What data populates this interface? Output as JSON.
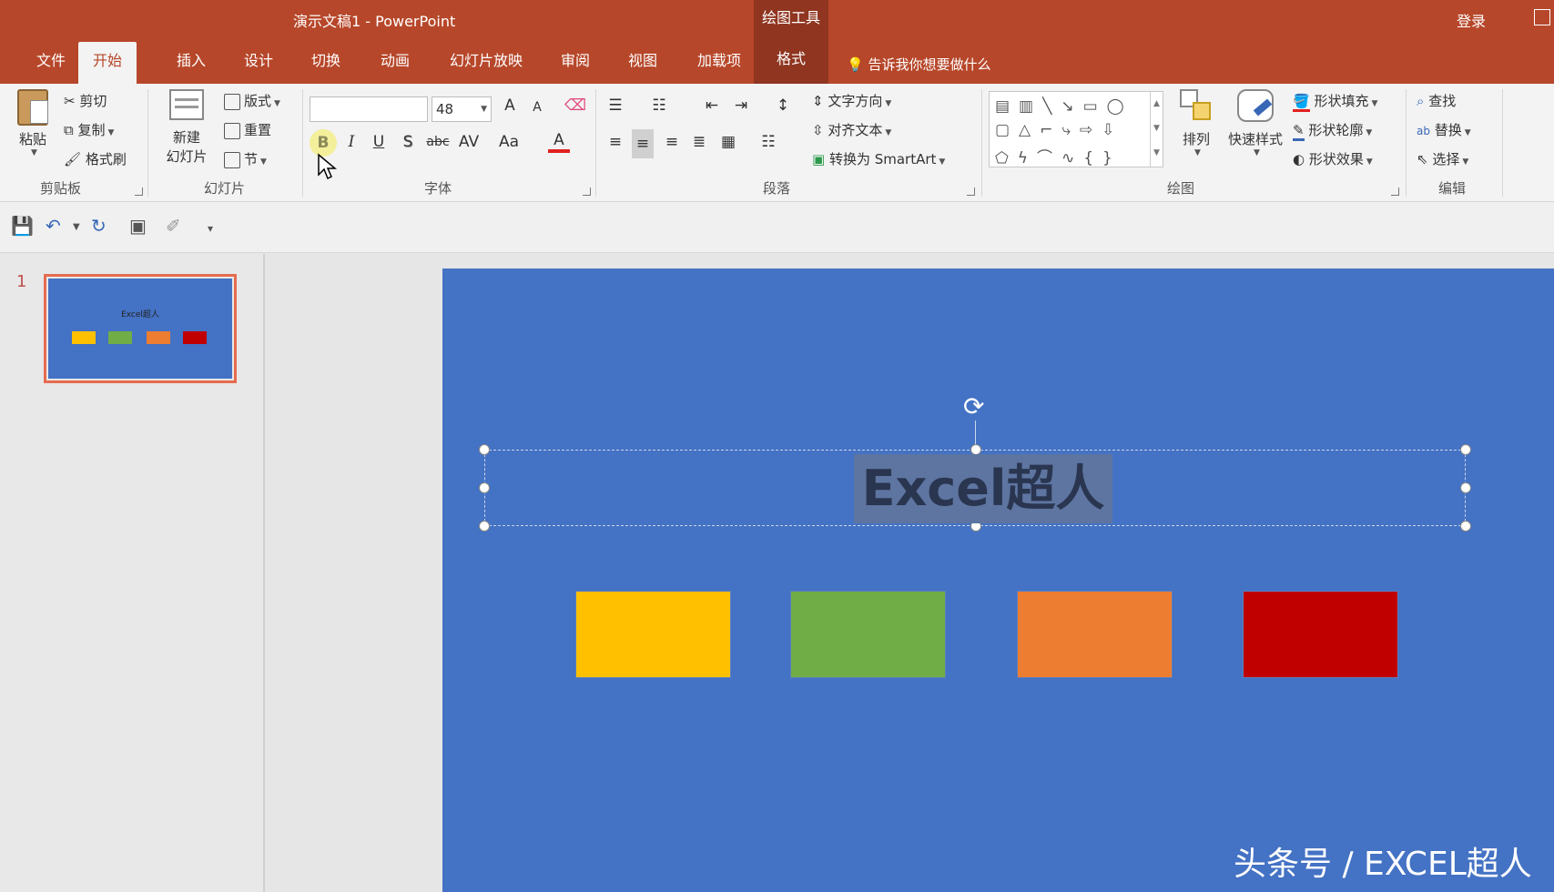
{
  "titlebar": {
    "doc_title": "演示文稿1  -  PowerPoint",
    "context_tool": "绘图工具",
    "login": "登录"
  },
  "tabs": [
    "文件",
    "开始",
    "插入",
    "设计",
    "切换",
    "动画",
    "幻灯片放映",
    "审阅",
    "视图",
    "加载项",
    "格式"
  ],
  "active_tab": "开始",
  "tell_me": "告诉我你想要做什么",
  "clipboard": {
    "paste": "粘贴",
    "cut": "剪切",
    "copy": "复制",
    "format_painter": "格式刷",
    "label": "剪贴板"
  },
  "slides_group": {
    "new_slide_1": "新建",
    "new_slide_2": "幻灯片",
    "layout": "版式",
    "reset": "重置",
    "section": "节",
    "label": "幻灯片"
  },
  "font_group": {
    "font_name": "",
    "font_size": "48",
    "bold": "B",
    "italic": "I",
    "underline": "U",
    "shadow": "S",
    "strike": "abc",
    "spacing": "AV",
    "case": "Aa",
    "color": "A",
    "grow": "A",
    "shrink": "A",
    "label": "字体"
  },
  "paragraph_group": {
    "text_direction": "文字方向",
    "align_text": "对齐文本",
    "smartart": "转换为 SmartArt",
    "label": "段落"
  },
  "drawing_group": {
    "arrange": "排列",
    "quick_styles": "快速样式",
    "fill": "形状填充",
    "outline": "形状轮廓",
    "effects": "形状效果",
    "label": "绘图"
  },
  "editing_group": {
    "find": "查找",
    "replace": "替换",
    "select": "选择",
    "label": "编辑"
  },
  "slide_panel": {
    "slide_number": "1",
    "thumb_title": "Excel超人"
  },
  "slide": {
    "title": "Excel超人",
    "boxes": [
      {
        "name": "yellow-rectangle",
        "color": "#ffc000"
      },
      {
        "name": "green-rectangle",
        "color": "#70ad47"
      },
      {
        "name": "orange-rectangle",
        "color": "#ed7d31"
      },
      {
        "name": "red-rectangle",
        "color": "#c00000"
      }
    ]
  },
  "watermark": "头条号 / EXCEL超人",
  "colors": {
    "accent": "#b7472a",
    "slide_bg": "#4472c4"
  }
}
